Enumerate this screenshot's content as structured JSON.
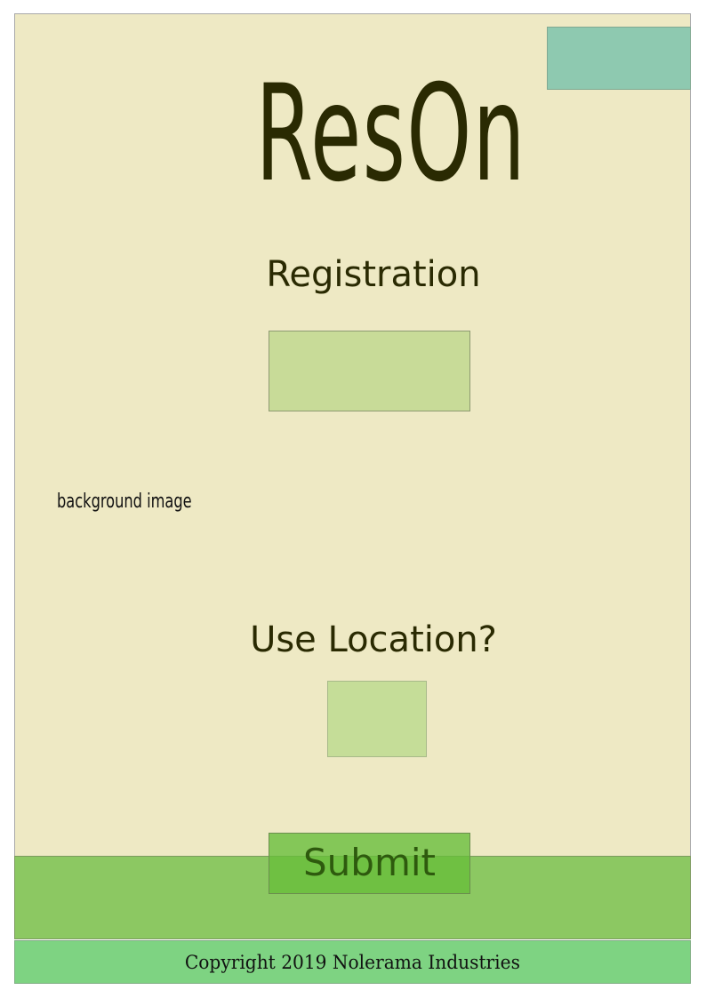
{
  "app": {
    "logo_text": "ResOn"
  },
  "registration": {
    "title": "Registration"
  },
  "background": {
    "label": "background image"
  },
  "location": {
    "title": "Use Location?"
  },
  "actions": {
    "submit_label": "Submit"
  },
  "footer": {
    "copyright": "Copyright 2019 Nolerama Industries"
  },
  "colors": {
    "page_background": "#EEE9C4",
    "corner_box": "#8EC9B0",
    "field_placeholder": "#C8DB98",
    "bottom_band": "#8CC862",
    "submit_button": "#67BE3A",
    "footer": "#7ED382",
    "text_dark": "#2A2A02"
  }
}
